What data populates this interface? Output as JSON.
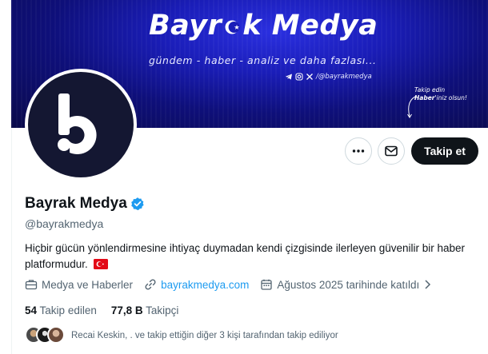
{
  "banner": {
    "title_left": "Bayr",
    "title_right": "k Medya",
    "tagline": "gündem - haber - analiz ve daha fazlası...",
    "social_handle": "/@bayrakmedya",
    "note_line1": "Takip edin",
    "note_bold": "Haber",
    "note_rest": "'iniz olsun!",
    "colors": {
      "background": "#0e0f7a",
      "text": "#ffffff"
    }
  },
  "actions": {
    "more_icon": "ellipsis-icon",
    "message_icon": "envelope-icon",
    "follow_label": "Takip et"
  },
  "profile": {
    "name": "Bayrak Medya",
    "verified_icon": "verified-badge-icon",
    "handle": "@bayrakmedya",
    "bio": "Hiçbir gücün yönlendirmesine ihtiyaç duymadan kendi çizgisinde ilerleyen güvenilir bir haber platformudur.",
    "category": "Medya ve Haberler",
    "website": "bayrakmedya.com",
    "joined": "Ağustos 2025 tarihinde katıldı",
    "following_count": "54",
    "following_label": "Takip edilen",
    "followers_count": "77,8 B",
    "followers_label": "Takipçi",
    "known_followers": "Recai Keskin, . ve takip ettiğin diğer 3 kişi tarafından takip ediliyor"
  },
  "colors": {
    "accent": "#1d9bf0",
    "primary_text": "#0f1419",
    "secondary_text": "#536471",
    "follow_button": "#0f1419"
  }
}
